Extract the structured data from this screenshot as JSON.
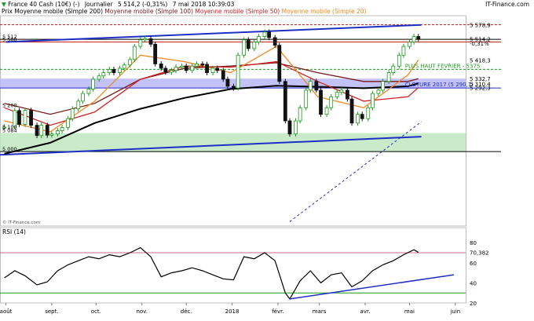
{
  "header": {
    "title": "France 40 Cash (10€) (-)",
    "period": "Journalier",
    "price_change": "5 514,2 (-0,31%)",
    "datetime": "7 mai 2018 10:39:03",
    "brand": "IT-Finance.com"
  },
  "legend": [
    {
      "label": "Prix",
      "color": "#000000"
    },
    {
      "label": "Moyenne mobile (Simple 200)",
      "color": "#000000"
    },
    {
      "label": "Moyenne mobile (Simple 100)",
      "color": "#7a1a1a"
    },
    {
      "label": "Moyenne mobile (Simple 50)",
      "color": "#cc2222"
    },
    {
      "label": "Moyenne mobile (Simple 20)",
      "color": "#ee8822"
    }
  ],
  "watermark": "© IT-Finance.com",
  "colors": {
    "price_up": "#1a9a1a",
    "price_down": "#111111",
    "sma200": "#000000",
    "sma100": "#7a1a1a",
    "sma50": "#cc2222",
    "sma20": "#ee8822",
    "trend_blue": "#1f2fc4",
    "zone_green": "#bfe7bf",
    "zone_blue": "#b7b7f5",
    "rsi": "#000000",
    "rsi_band": "#c76d8c",
    "rsi_trend": "#1f2fc4",
    "rsi_low": "#1a9a1a"
  },
  "chart_data": [
    {
      "type": "candlestick",
      "name_in_image": "France 40 Cash (10€) (-)",
      "ylim": [
        4660,
        5620
      ],
      "y_ticks": [
        "5 512",
        "5 500",
        "5 200",
        "5 100",
        "5 084",
        "5 000"
      ],
      "x_ticks": [
        "août",
        "sept.",
        "oct.",
        "nov.",
        "déc.",
        "2018",
        "févr.",
        "mars",
        "avr.",
        "mai",
        "juin"
      ],
      "price_markers": [
        {
          "label": "5 578,9",
          "value": 5578.9
        },
        {
          "label": "5 514,2",
          "value": 5514.2
        },
        {
          "label": "-0,31%",
          "value": 5495
        },
        {
          "label": "5 418,3",
          "value": 5418.3
        },
        {
          "label": "5 332,7",
          "value": 5332.7
        },
        {
          "label": "5 310,4",
          "value": 5310.4
        },
        {
          "label": "5 292,3",
          "value": 5292.3
        }
      ],
      "horizontal_lines": [
        {
          "value": 5578.9,
          "style": "dashed",
          "color": "#cc2222"
        },
        {
          "value": 5512,
          "style": "solid",
          "color": "#000000"
        },
        {
          "value": 5500,
          "style": "solid",
          "color": "#cc2222"
        },
        {
          "value": 5375,
          "style": "dashed",
          "color": "#1a9a1a"
        },
        {
          "value": 5290.1,
          "style": "solid",
          "color": "#1f2fc4"
        },
        {
          "value": 5000,
          "style": "solid",
          "color": "#000000"
        }
      ],
      "zones": [
        {
          "from": 5000,
          "to": 5084,
          "color": "#bfe7bf"
        },
        {
          "from": 5290.1,
          "to": 5332.7,
          "color": "#b7b7f5"
        }
      ],
      "trendlines": [
        {
          "from": [
            "2017-08-01",
            5500
          ],
          "to": [
            "2018-05-09",
            5578
          ],
          "color": "#1f2fc4"
        },
        {
          "from": [
            "2017-07-28",
            4985
          ],
          "to": [
            "2018-05-09",
            5068
          ],
          "color": "#1f2fc4"
        },
        {
          "from": [
            "2018-02-09",
            4680
          ],
          "to": [
            "2018-05-09",
            5136
          ],
          "color": "#1f2fc4",
          "style": "dashed"
        }
      ],
      "annotations": [
        {
          "text": "PLUS HAUT FEVRIER - 5375",
          "value": 5375
        },
        {
          "text": "CLOTURE 2017 (5 290,1)",
          "value": 5290.1
        }
      ],
      "series": [
        {
          "name": "Prix",
          "points": [
            [
              "2017-07-31",
              5112
            ],
            [
              "2017-08-07",
              5187
            ],
            [
              "2017-08-10",
              5124
            ],
            [
              "2017-08-14",
              5188
            ],
            [
              "2017-08-18",
              5120
            ],
            [
              "2017-08-22",
              5073
            ],
            [
              "2017-08-25",
              5120
            ],
            [
              "2017-08-29",
              5075
            ],
            [
              "2017-09-01",
              5080
            ],
            [
              "2017-09-05",
              5095
            ],
            [
              "2017-09-08",
              5110
            ],
            [
              "2017-09-12",
              5150
            ],
            [
              "2017-09-15",
              5195
            ],
            [
              "2017-09-19",
              5230
            ],
            [
              "2017-09-22",
              5265
            ],
            [
              "2017-09-26",
              5285
            ],
            [
              "2017-09-29",
              5330
            ],
            [
              "2017-10-03",
              5345
            ],
            [
              "2017-10-06",
              5360
            ],
            [
              "2017-10-10",
              5375
            ],
            [
              "2017-10-13",
              5360
            ],
            [
              "2017-10-17",
              5380
            ],
            [
              "2017-10-20",
              5395
            ],
            [
              "2017-10-24",
              5420
            ],
            [
              "2017-10-27",
              5480
            ],
            [
              "2017-10-31",
              5510
            ],
            [
              "2017-11-03",
              5515
            ],
            [
              "2017-11-07",
              5490
            ],
            [
              "2017-11-10",
              5400
            ],
            [
              "2017-11-14",
              5380
            ],
            [
              "2017-11-17",
              5362
            ],
            [
              "2017-11-21",
              5370
            ],
            [
              "2017-11-24",
              5385
            ],
            [
              "2017-11-28",
              5390
            ],
            [
              "2017-12-01",
              5370
            ],
            [
              "2017-12-05",
              5390
            ],
            [
              "2017-12-08",
              5400
            ],
            [
              "2017-12-12",
              5398
            ],
            [
              "2017-12-15",
              5360
            ],
            [
              "2017-12-19",
              5380
            ],
            [
              "2017-12-22",
              5370
            ],
            [
              "2017-12-26",
              5330
            ],
            [
              "2017-12-29",
              5298
            ],
            [
              "2018-01-02",
              5290
            ],
            [
              "2018-01-05",
              5440
            ],
            [
              "2018-01-09",
              5510
            ],
            [
              "2018-01-12",
              5470
            ],
            [
              "2018-01-16",
              5500
            ],
            [
              "2018-01-19",
              5525
            ],
            [
              "2018-01-23",
              5545
            ],
            [
              "2018-01-26",
              5520
            ],
            [
              "2018-01-30",
              5485
            ],
            [
              "2018-02-02",
              5320
            ],
            [
              "2018-02-06",
              5140
            ],
            [
              "2018-02-09",
              5080
            ],
            [
              "2018-02-13",
              5140
            ],
            [
              "2018-02-16",
              5200
            ],
            [
              "2018-02-20",
              5280
            ],
            [
              "2018-02-23",
              5320
            ],
            [
              "2018-02-27",
              5280
            ],
            [
              "2018-03-02",
              5170
            ],
            [
              "2018-03-06",
              5200
            ],
            [
              "2018-03-09",
              5250
            ],
            [
              "2018-03-13",
              5270
            ],
            [
              "2018-03-16",
              5280
            ],
            [
              "2018-03-20",
              5240
            ],
            [
              "2018-03-23",
              5130
            ],
            [
              "2018-03-27",
              5170
            ],
            [
              "2018-03-30",
              5150
            ],
            [
              "2018-04-03",
              5200
            ],
            [
              "2018-04-06",
              5265
            ],
            [
              "2018-04-10",
              5280
            ],
            [
              "2018-04-13",
              5320
            ],
            [
              "2018-04-17",
              5360
            ],
            [
              "2018-04-20",
              5390
            ],
            [
              "2018-04-24",
              5440
            ],
            [
              "2018-04-27",
              5480
            ],
            [
              "2018-05-01",
              5500
            ],
            [
              "2018-05-04",
              5525
            ],
            [
              "2018-05-07",
              5514.2
            ]
          ]
        },
        {
          "name": "Moyenne mobile (Simple 200)",
          "points": [
            [
              "2017-07-31",
              4990
            ],
            [
              "2017-08-31",
              5040
            ],
            [
              "2017-09-30",
              5130
            ],
            [
              "2017-10-31",
              5195
            ],
            [
              "2017-11-30",
              5245
            ],
            [
              "2017-12-31",
              5285
            ],
            [
              "2018-01-31",
              5300
            ],
            [
              "2018-02-28",
              5296
            ],
            [
              "2018-03-31",
              5289
            ],
            [
              "2018-04-30",
              5298
            ],
            [
              "2018-05-07",
              5310.4
            ]
          ]
        },
        {
          "name": "Moyenne mobile (Simple 100)",
          "points": [
            [
              "2017-07-31",
              5220
            ],
            [
              "2017-08-31",
              5170
            ],
            [
              "2017-09-30",
              5220
            ],
            [
              "2017-10-31",
              5330
            ],
            [
              "2017-11-30",
              5380
            ],
            [
              "2017-12-31",
              5390
            ],
            [
              "2018-01-31",
              5405
            ],
            [
              "2018-02-28",
              5360
            ],
            [
              "2018-03-31",
              5320
            ],
            [
              "2018-04-30",
              5320
            ],
            [
              "2018-05-07",
              5332.7
            ]
          ]
        },
        {
          "name": "Moyenne mobile (Simple 50)",
          "points": [
            [
              "2017-07-31",
              5200
            ],
            [
              "2017-08-31",
              5120
            ],
            [
              "2017-09-30",
              5180
            ],
            [
              "2017-10-31",
              5330
            ],
            [
              "2017-11-30",
              5390
            ],
            [
              "2017-12-31",
              5385
            ],
            [
              "2018-01-31",
              5410
            ],
            [
              "2018-02-28",
              5320
            ],
            [
              "2018-03-31",
              5230
            ],
            [
              "2018-04-30",
              5250
            ],
            [
              "2018-05-07",
              5292.3
            ]
          ]
        },
        {
          "name": "Moyenne mobile (Simple 20)",
          "points": [
            [
              "2017-07-31",
              5140
            ],
            [
              "2017-08-31",
              5090
            ],
            [
              "2017-09-30",
              5230
            ],
            [
              "2017-10-31",
              5440
            ],
            [
              "2017-11-30",
              5410
            ],
            [
              "2017-12-31",
              5360
            ],
            [
              "2018-01-31",
              5480
            ],
            [
              "2018-02-28",
              5250
            ],
            [
              "2018-03-31",
              5200
            ],
            [
              "2018-04-30",
              5350
            ],
            [
              "2018-05-07",
              5418.3
            ]
          ]
        }
      ]
    },
    {
      "type": "line",
      "name_in_image": "RSI (14)",
      "ylim": [
        20,
        95
      ],
      "y_ticks": [
        "80",
        "60",
        "40",
        "20"
      ],
      "value_label": "70,382",
      "band_lines": [
        70,
        30
      ],
      "series": [
        {
          "name": "RSI (14)",
          "points": [
            [
              "2017-07-31",
              45
            ],
            [
              "2017-08-07",
              52
            ],
            [
              "2017-08-14",
              47
            ],
            [
              "2017-08-22",
              38
            ],
            [
              "2017-08-29",
              41
            ],
            [
              "2017-09-05",
              52
            ],
            [
              "2017-09-12",
              58
            ],
            [
              "2017-09-19",
              62
            ],
            [
              "2017-09-26",
              66
            ],
            [
              "2017-10-03",
              64
            ],
            [
              "2017-10-10",
              68
            ],
            [
              "2017-10-17",
              66
            ],
            [
              "2017-10-24",
              70
            ],
            [
              "2017-10-31",
              75
            ],
            [
              "2017-11-07",
              66
            ],
            [
              "2017-11-14",
              46
            ],
            [
              "2017-11-21",
              50
            ],
            [
              "2017-11-28",
              52
            ],
            [
              "2017-12-05",
              55
            ],
            [
              "2017-12-12",
              52
            ],
            [
              "2017-12-19",
              48
            ],
            [
              "2017-12-26",
              44
            ],
            [
              "2018-01-02",
              43
            ],
            [
              "2018-01-09",
              66
            ],
            [
              "2018-01-16",
              64
            ],
            [
              "2018-01-23",
              70
            ],
            [
              "2018-01-30",
              62
            ],
            [
              "2018-02-06",
              30
            ],
            [
              "2018-02-09",
              24
            ],
            [
              "2018-02-16",
              42
            ],
            [
              "2018-02-23",
              52
            ],
            [
              "2018-03-02",
              40
            ],
            [
              "2018-03-09",
              48
            ],
            [
              "2018-03-16",
              50
            ],
            [
              "2018-03-23",
              36
            ],
            [
              "2018-03-30",
              42
            ],
            [
              "2018-04-06",
              52
            ],
            [
              "2018-04-13",
              58
            ],
            [
              "2018-04-20",
              62
            ],
            [
              "2018-04-27",
              68
            ],
            [
              "2018-05-04",
              73
            ],
            [
              "2018-05-07",
              70.382
            ]
          ]
        }
      ],
      "trendline": {
        "from": [
          "2018-02-09",
          24
        ],
        "to": [
          "2018-05-31",
          48
        ]
      }
    }
  ]
}
